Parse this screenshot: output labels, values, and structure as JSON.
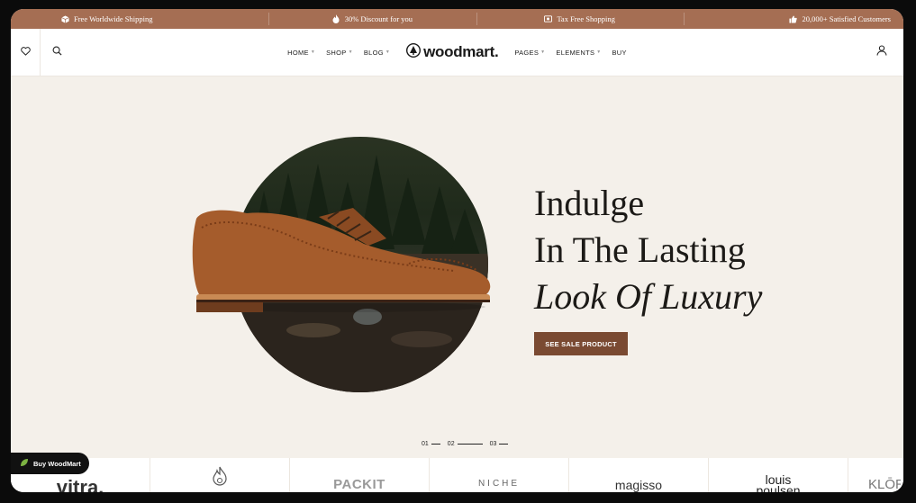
{
  "promo": {
    "items": [
      {
        "icon": "box-icon",
        "label": "Free Worldwide Shipping"
      },
      {
        "icon": "flame-icon",
        "label": "30% Discount for you"
      },
      {
        "icon": "card-icon",
        "label": "Tax Free Shopping"
      },
      {
        "icon": "thumbs-up-icon",
        "label": "20,000+ Satisfied Customers"
      }
    ]
  },
  "header": {
    "logo": "woodmart.",
    "nav_left": [
      "HOME",
      "SHOP",
      "BLOG"
    ],
    "nav_right": [
      "PAGES",
      "ELEMENTS",
      "BUY"
    ]
  },
  "hero": {
    "line1": "Indulge",
    "line2": "In The Lasting",
    "line3": "Look Of Luxury",
    "cta": "SEE SALE PRODUCT"
  },
  "pager": [
    "01",
    "02",
    "03"
  ],
  "brands": [
    "vitra.",
    "",
    "PACKIT",
    "NICHE",
    "magisso",
    "louis poulsen",
    "KLŌR"
  ],
  "buy_button": "Buy WoodMart",
  "colors": {
    "accent": "#a56e53",
    "cta": "#7a4a32",
    "background": "#f4f0ea"
  }
}
